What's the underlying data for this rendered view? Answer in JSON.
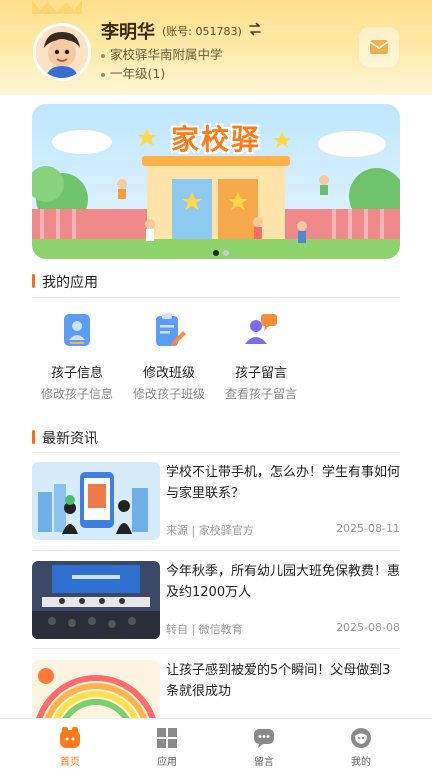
{
  "header": {
    "name": "李明华",
    "account": "(账号: 051783)",
    "school": "家校驿华南附属中学",
    "grade": "一年级(1)"
  },
  "banner": {
    "title": "家校驿",
    "page_count": 2,
    "active_page": 1
  },
  "apps_section": {
    "title": "我的应用",
    "items": [
      {
        "label": "孩子信息",
        "desc": "修改孩子信息",
        "icon": "id-card-icon"
      },
      {
        "label": "修改班级",
        "desc": "修改孩子班级",
        "icon": "clipboard-edit-icon"
      },
      {
        "label": "孩子留言",
        "desc": "查看孩子留言",
        "icon": "user-message-icon"
      }
    ]
  },
  "news_section": {
    "title": "最新资讯",
    "items": [
      {
        "title": "学校不让带手机，怎么办！学生有事如何与家里联系？",
        "source": "来源 | 家校驿官方",
        "date": "2025-08-11"
      },
      {
        "title": "今年秋季，所有幼儿园大班免保教费！惠及约1200万人",
        "source": "转自 | 微信教育",
        "date": "2025-08-08"
      },
      {
        "title": "让孩子感到被爱的5个瞬间！父母做到3条就很成功",
        "source": "",
        "date": ""
      }
    ]
  },
  "tabbar": {
    "items": [
      {
        "label": "首页",
        "icon": "home-icon",
        "active": true
      },
      {
        "label": "应用",
        "icon": "grid-icon",
        "active": false
      },
      {
        "label": "留言",
        "icon": "chat-icon",
        "active": false
      },
      {
        "label": "我的",
        "icon": "profile-icon",
        "active": false
      }
    ]
  },
  "colors": {
    "accent": "#ff7a1a",
    "header_bg": "#ffe08a"
  }
}
